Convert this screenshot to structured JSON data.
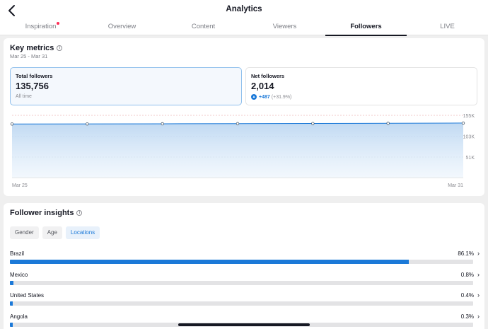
{
  "header": {
    "title": "Analytics",
    "back_icon": "chevron-left-icon"
  },
  "tabs": [
    {
      "label": "Inspiration",
      "badge": true
    },
    {
      "label": "Overview"
    },
    {
      "label": "Content"
    },
    {
      "label": "Viewers"
    },
    {
      "label": "Followers",
      "active": true
    },
    {
      "label": "LIVE"
    }
  ],
  "key_metrics": {
    "title": "Key metrics",
    "date_range": "Mar 25 - Mar 31",
    "total_followers": {
      "label": "Total followers",
      "value": "135,756",
      "sub": "All time"
    },
    "net_followers": {
      "label": "Net followers",
      "value": "2,014",
      "change": "+487",
      "change_pct": "(+31.9%)"
    }
  },
  "chart_data": {
    "type": "area",
    "x": [
      "Mar 25",
      "Mar 26",
      "Mar 27",
      "Mar 28",
      "Mar 29",
      "Mar 30",
      "Mar 31"
    ],
    "xticklabels": [
      "Mar 25",
      "Mar 31"
    ],
    "series": [
      {
        "values": [
          133400,
          133600,
          133900,
          134300,
          134700,
          135200,
          135756
        ]
      }
    ],
    "yticklabels": [
      "155K",
      "103K",
      "51K"
    ],
    "ylim": [
      0,
      155000
    ],
    "grid": true,
    "color": "#1b79d8"
  },
  "insights": {
    "title": "Follower insights",
    "filters": [
      "Gender",
      "Age",
      "Locations"
    ],
    "active_filter": "Locations",
    "locations": [
      {
        "name": "Brazil",
        "pct": "86.1%",
        "value": 86.1
      },
      {
        "name": "Mexico",
        "pct": "0.8%",
        "value": 0.8
      },
      {
        "name": "United States",
        "pct": "0.4%",
        "value": 0.4
      },
      {
        "name": "Angola",
        "pct": "0.3%",
        "value": 0.3
      }
    ]
  }
}
